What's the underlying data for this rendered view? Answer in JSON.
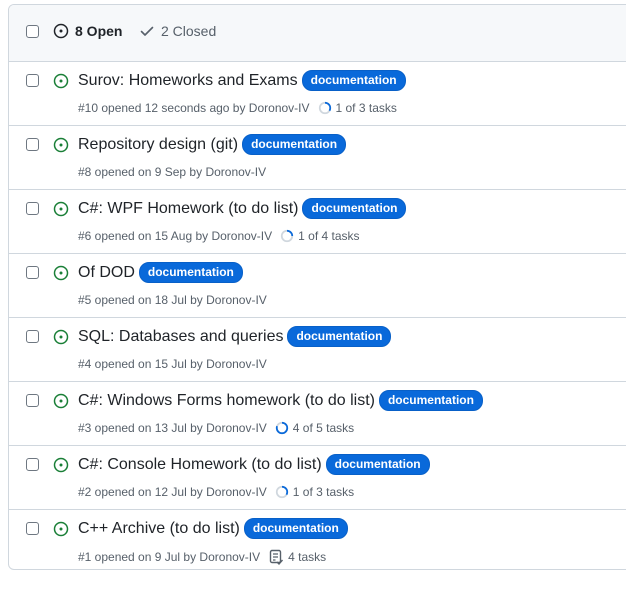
{
  "header": {
    "open_label": "8 Open",
    "closed_label": "2 Closed"
  },
  "colors": {
    "open_icon": "#1a7f37",
    "label_bg": "#0969da",
    "progress": "#0969da"
  },
  "issues": [
    {
      "title": "Surov: Homeworks and Exams",
      "label": "documentation",
      "meta": "#10 opened 12 seconds ago by Doronov-IV",
      "tasks": "1 of 3 tasks",
      "tasks_done": 1,
      "tasks_total": 3,
      "task_icon": "progress-ring-icon"
    },
    {
      "title": "Repository design (git)",
      "label": "documentation",
      "meta": "#8 opened on 9 Sep by Doronov-IV"
    },
    {
      "title": "C#: WPF Homework (to do list)",
      "label": "documentation",
      "meta": "#6 opened on 15 Aug by Doronov-IV",
      "tasks": "1 of 4 tasks",
      "tasks_done": 1,
      "tasks_total": 4,
      "task_icon": "progress-ring-icon"
    },
    {
      "title": "Of DOD",
      "label": "documentation",
      "meta": "#5 opened on 18 Jul by Doronov-IV"
    },
    {
      "title": "SQL: Databases and queries",
      "label": "documentation",
      "meta": "#4 opened on 15 Jul by Doronov-IV"
    },
    {
      "title": "C#: Windows Forms homework (to do list)",
      "label": "documentation",
      "meta": "#3 opened on 13 Jul by Doronov-IV",
      "tasks": "4 of 5 tasks",
      "tasks_done": 4,
      "tasks_total": 5,
      "task_icon": "progress-ring-icon"
    },
    {
      "title": "C#: Console Homework (to do list)",
      "label": "documentation",
      "meta": "#2 opened on 12 Jul by Doronov-IV",
      "tasks": "1 of 3 tasks",
      "tasks_done": 1,
      "tasks_total": 3,
      "task_icon": "progress-ring-icon"
    },
    {
      "title": "C++ Archive (to do list)",
      "label": "documentation",
      "meta": "#1 opened on 9 Jul by Doronov-IV",
      "tasks": "4 tasks",
      "task_icon": "tasklist-icon"
    }
  ]
}
